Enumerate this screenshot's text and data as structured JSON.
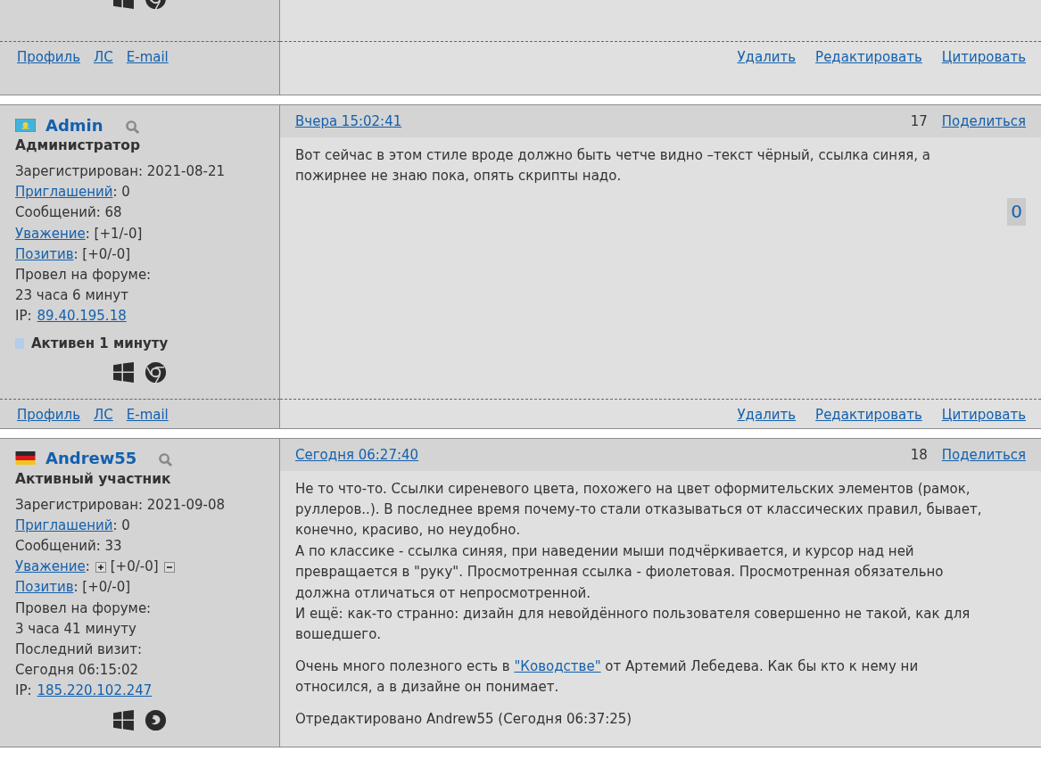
{
  "posts": [
    {
      "client": {
        "kind": "chrome"
      },
      "author_links": [
        "Профиль",
        "ЛС",
        "E-mail"
      ],
      "actions": [
        "Удалить",
        "Редактировать",
        "Цитировать"
      ]
    },
    {
      "author": {
        "name": "Admin",
        "flag": {
          "kind": "kz"
        },
        "rank": "Администратор"
      },
      "stats": [
        {
          "kind": "text",
          "text": "Зарегистрирован: 2021-08-21"
        },
        {
          "kind": "link",
          "label": "Приглашений",
          "value": ": 0"
        },
        {
          "kind": "text",
          "text": "Сообщений: 68"
        },
        {
          "kind": "link",
          "label": "Уважение",
          "value": ": [+1/-0]"
        },
        {
          "kind": "link",
          "label": "Позитив",
          "value": ": [+0/-0]"
        },
        {
          "kind": "text",
          "text": "Провел на форуме:"
        },
        {
          "kind": "text",
          "text": "23 часа 6 минут"
        },
        {
          "kind": "ip",
          "label": "IP:",
          "value": "89.40.195.18"
        }
      ],
      "activity": {
        "text": "Активен 1 минуту",
        "color": "#b3cdea"
      },
      "client": {
        "kind": "chrome"
      },
      "date": "Вчера 15:02:41",
      "number": "17",
      "share": "Поделиться",
      "paragraphs": [
        {
          "lines": [
            [
              {
                "text": "Вот сейчас в этом стиле вроде должно быть четче видно –текст чёрный, ссылка синяя, а пожирнее не знаю пока, опять скрипты надо."
              }
            ]
          ]
        }
      ],
      "rating": "0",
      "author_links": [
        "Профиль",
        "ЛС",
        "E-mail"
      ],
      "actions": [
        "Удалить",
        "Редактировать",
        "Цитировать"
      ]
    },
    {
      "author": {
        "name": "Andrew55",
        "flag": {
          "kind": "de"
        },
        "rank": "Активный участник"
      },
      "stats": [
        {
          "kind": "text",
          "text": "Зарегистрирован: 2021-09-08"
        },
        {
          "kind": "link",
          "label": "Приглашений",
          "value": ": 0"
        },
        {
          "kind": "text",
          "text": "Сообщений: 33"
        },
        {
          "kind": "vote",
          "label": "Уважение",
          "colon": ":",
          "value": "[+0/-0]"
        },
        {
          "kind": "link",
          "label": "Позитив",
          "value": ": [+0/-0]"
        },
        {
          "kind": "text",
          "text": "Провел на форуме:"
        },
        {
          "kind": "text",
          "text": "3 часа 41 минуту"
        },
        {
          "kind": "text",
          "text": "Последний визит:"
        },
        {
          "kind": "text",
          "text": "Сегодня 06:15:02"
        },
        {
          "kind": "ip",
          "label": "IP:",
          "value": "185.220.102.247"
        }
      ],
      "client": {
        "kind": "firefox"
      },
      "date": "Сегодня 06:27:40",
      "number": "18",
      "share": "Поделиться",
      "paragraphs": [
        {
          "lines": [
            [
              {
                "text": "Не то что-то. Ссылки сиреневого цвета, похожего на цвет оформительских элементов (рамок, руллеров..). В последнее время почему-то стали отказываться от классических правил, бывает, конечно, красиво, но неудобно."
              }
            ],
            [
              {
                "text": "А по классике - ссылка синяя, при наведении мыши подчёркивается, и курсор над ней превращается в \"руку\". Просмотренная ссылка - фиолетовая. Просмотренная обязательно должна отличаться от непросмотренной."
              }
            ],
            [
              {
                "text": "И ещё: как-то странно: дизайн для невойдённого пользователя совершенно не такой, как для вошедшего."
              }
            ]
          ]
        },
        {
          "lines": [
            [
              {
                "text": "Очень много полезного есть в "
              },
              {
                "link": "\"Ководстве\""
              },
              {
                "text": " от Артемий Лебедева. Как бы кто к нему ни относился, а в дизайне он понимает."
              }
            ]
          ]
        }
      ],
      "edited": "Отредактировано Andrew55 (Сегодня 06:37:25)"
    }
  ]
}
